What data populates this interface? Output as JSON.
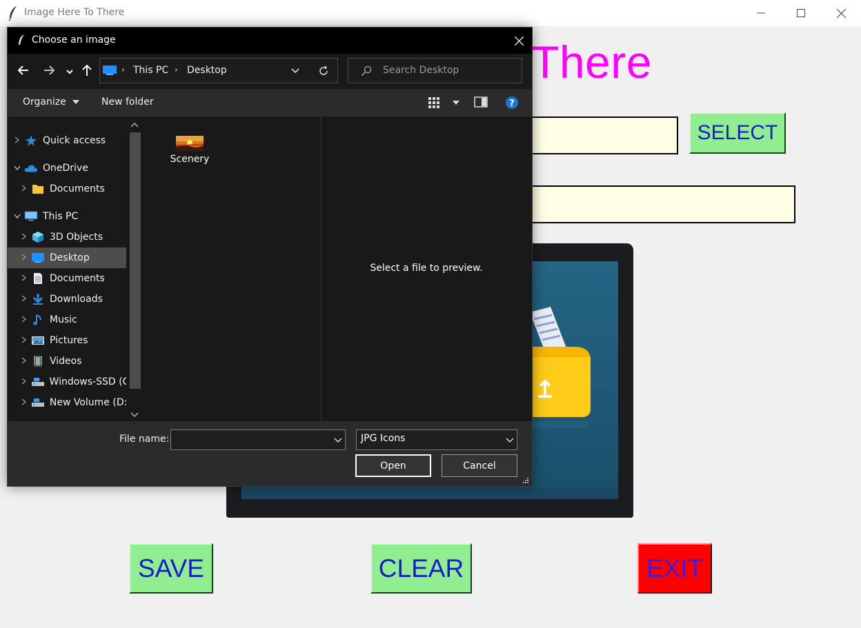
{
  "app": {
    "title": "Image Here To There",
    "heading_visible": "There",
    "buttons": {
      "select": "SELECT",
      "save": "SAVE",
      "clear": "CLEAR",
      "exit": "EXIT"
    },
    "entry1_value": "",
    "entry2_value": ""
  },
  "dialog": {
    "title": "Choose an image",
    "breadcrumb": [
      "This PC",
      "Desktop"
    ],
    "search_placeholder": "Search Desktop",
    "commands": {
      "organize": "Organize",
      "new_folder": "New folder"
    },
    "nav": [
      {
        "label": "Quick access",
        "icon": "star-icon",
        "indent": 0,
        "chevron": "right"
      },
      {
        "label": "OneDrive",
        "icon": "cloud-icon",
        "indent": 0,
        "chevron": "down"
      },
      {
        "label": "Documents",
        "icon": "folder-icon",
        "indent": 1,
        "chevron": "right"
      },
      {
        "label": "This PC",
        "icon": "computer-icon",
        "indent": 0,
        "chevron": "down"
      },
      {
        "label": "3D Objects",
        "icon": "cube-icon",
        "indent": 1,
        "chevron": "right"
      },
      {
        "label": "Desktop",
        "icon": "desktop-icon",
        "indent": 1,
        "chevron": "right",
        "selected": true
      },
      {
        "label": "Documents",
        "icon": "document-icon",
        "indent": 1,
        "chevron": "right"
      },
      {
        "label": "Downloads",
        "icon": "download-icon",
        "indent": 1,
        "chevron": "right"
      },
      {
        "label": "Music",
        "icon": "music-icon",
        "indent": 1,
        "chevron": "right"
      },
      {
        "label": "Pictures",
        "icon": "pictures-icon",
        "indent": 1,
        "chevron": "right"
      },
      {
        "label": "Videos",
        "icon": "video-icon",
        "indent": 1,
        "chevron": "right"
      },
      {
        "label": "Windows-SSD (C",
        "icon": "drive-icon",
        "indent": 1,
        "chevron": "right"
      },
      {
        "label": "New Volume (D:",
        "icon": "drive-icon",
        "indent": 1,
        "chevron": "right"
      }
    ],
    "files": [
      {
        "name": "Scenery",
        "icon": "image-file-icon"
      }
    ],
    "preview_text": "Select a file to preview.",
    "filename_label": "File name:",
    "filename_value": "",
    "filetype": "JPG Icons",
    "open_label": "Open",
    "cancel_label": "Cancel"
  },
  "colors": {
    "heading": "#ff00ff",
    "button_green": "#90ee90",
    "button_text": "#1a1acd",
    "exit_red": "#ff0000",
    "entry_bg": "#ffffe5",
    "dialog_bg": "#202020"
  }
}
